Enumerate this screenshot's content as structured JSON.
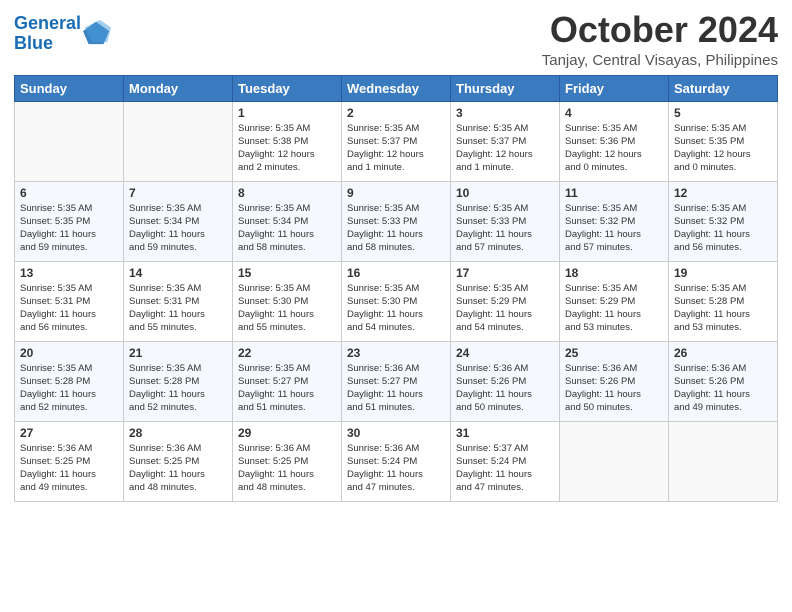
{
  "header": {
    "logo_line1": "General",
    "logo_line2": "Blue",
    "month": "October 2024",
    "location": "Tanjay, Central Visayas, Philippines"
  },
  "weekdays": [
    "Sunday",
    "Monday",
    "Tuesday",
    "Wednesday",
    "Thursday",
    "Friday",
    "Saturday"
  ],
  "weeks": [
    [
      {
        "day": "",
        "info": ""
      },
      {
        "day": "",
        "info": ""
      },
      {
        "day": "1",
        "info": "Sunrise: 5:35 AM\nSunset: 5:38 PM\nDaylight: 12 hours\nand 2 minutes."
      },
      {
        "day": "2",
        "info": "Sunrise: 5:35 AM\nSunset: 5:37 PM\nDaylight: 12 hours\nand 1 minute."
      },
      {
        "day": "3",
        "info": "Sunrise: 5:35 AM\nSunset: 5:37 PM\nDaylight: 12 hours\nand 1 minute."
      },
      {
        "day": "4",
        "info": "Sunrise: 5:35 AM\nSunset: 5:36 PM\nDaylight: 12 hours\nand 0 minutes."
      },
      {
        "day": "5",
        "info": "Sunrise: 5:35 AM\nSunset: 5:35 PM\nDaylight: 12 hours\nand 0 minutes."
      }
    ],
    [
      {
        "day": "6",
        "info": "Sunrise: 5:35 AM\nSunset: 5:35 PM\nDaylight: 11 hours\nand 59 minutes."
      },
      {
        "day": "7",
        "info": "Sunrise: 5:35 AM\nSunset: 5:34 PM\nDaylight: 11 hours\nand 59 minutes."
      },
      {
        "day": "8",
        "info": "Sunrise: 5:35 AM\nSunset: 5:34 PM\nDaylight: 11 hours\nand 58 minutes."
      },
      {
        "day": "9",
        "info": "Sunrise: 5:35 AM\nSunset: 5:33 PM\nDaylight: 11 hours\nand 58 minutes."
      },
      {
        "day": "10",
        "info": "Sunrise: 5:35 AM\nSunset: 5:33 PM\nDaylight: 11 hours\nand 57 minutes."
      },
      {
        "day": "11",
        "info": "Sunrise: 5:35 AM\nSunset: 5:32 PM\nDaylight: 11 hours\nand 57 minutes."
      },
      {
        "day": "12",
        "info": "Sunrise: 5:35 AM\nSunset: 5:32 PM\nDaylight: 11 hours\nand 56 minutes."
      }
    ],
    [
      {
        "day": "13",
        "info": "Sunrise: 5:35 AM\nSunset: 5:31 PM\nDaylight: 11 hours\nand 56 minutes."
      },
      {
        "day": "14",
        "info": "Sunrise: 5:35 AM\nSunset: 5:31 PM\nDaylight: 11 hours\nand 55 minutes."
      },
      {
        "day": "15",
        "info": "Sunrise: 5:35 AM\nSunset: 5:30 PM\nDaylight: 11 hours\nand 55 minutes."
      },
      {
        "day": "16",
        "info": "Sunrise: 5:35 AM\nSunset: 5:30 PM\nDaylight: 11 hours\nand 54 minutes."
      },
      {
        "day": "17",
        "info": "Sunrise: 5:35 AM\nSunset: 5:29 PM\nDaylight: 11 hours\nand 54 minutes."
      },
      {
        "day": "18",
        "info": "Sunrise: 5:35 AM\nSunset: 5:29 PM\nDaylight: 11 hours\nand 53 minutes."
      },
      {
        "day": "19",
        "info": "Sunrise: 5:35 AM\nSunset: 5:28 PM\nDaylight: 11 hours\nand 53 minutes."
      }
    ],
    [
      {
        "day": "20",
        "info": "Sunrise: 5:35 AM\nSunset: 5:28 PM\nDaylight: 11 hours\nand 52 minutes."
      },
      {
        "day": "21",
        "info": "Sunrise: 5:35 AM\nSunset: 5:28 PM\nDaylight: 11 hours\nand 52 minutes."
      },
      {
        "day": "22",
        "info": "Sunrise: 5:35 AM\nSunset: 5:27 PM\nDaylight: 11 hours\nand 51 minutes."
      },
      {
        "day": "23",
        "info": "Sunrise: 5:36 AM\nSunset: 5:27 PM\nDaylight: 11 hours\nand 51 minutes."
      },
      {
        "day": "24",
        "info": "Sunrise: 5:36 AM\nSunset: 5:26 PM\nDaylight: 11 hours\nand 50 minutes."
      },
      {
        "day": "25",
        "info": "Sunrise: 5:36 AM\nSunset: 5:26 PM\nDaylight: 11 hours\nand 50 minutes."
      },
      {
        "day": "26",
        "info": "Sunrise: 5:36 AM\nSunset: 5:26 PM\nDaylight: 11 hours\nand 49 minutes."
      }
    ],
    [
      {
        "day": "27",
        "info": "Sunrise: 5:36 AM\nSunset: 5:25 PM\nDaylight: 11 hours\nand 49 minutes."
      },
      {
        "day": "28",
        "info": "Sunrise: 5:36 AM\nSunset: 5:25 PM\nDaylight: 11 hours\nand 48 minutes."
      },
      {
        "day": "29",
        "info": "Sunrise: 5:36 AM\nSunset: 5:25 PM\nDaylight: 11 hours\nand 48 minutes."
      },
      {
        "day": "30",
        "info": "Sunrise: 5:36 AM\nSunset: 5:24 PM\nDaylight: 11 hours\nand 47 minutes."
      },
      {
        "day": "31",
        "info": "Sunrise: 5:37 AM\nSunset: 5:24 PM\nDaylight: 11 hours\nand 47 minutes."
      },
      {
        "day": "",
        "info": ""
      },
      {
        "day": "",
        "info": ""
      }
    ]
  ]
}
